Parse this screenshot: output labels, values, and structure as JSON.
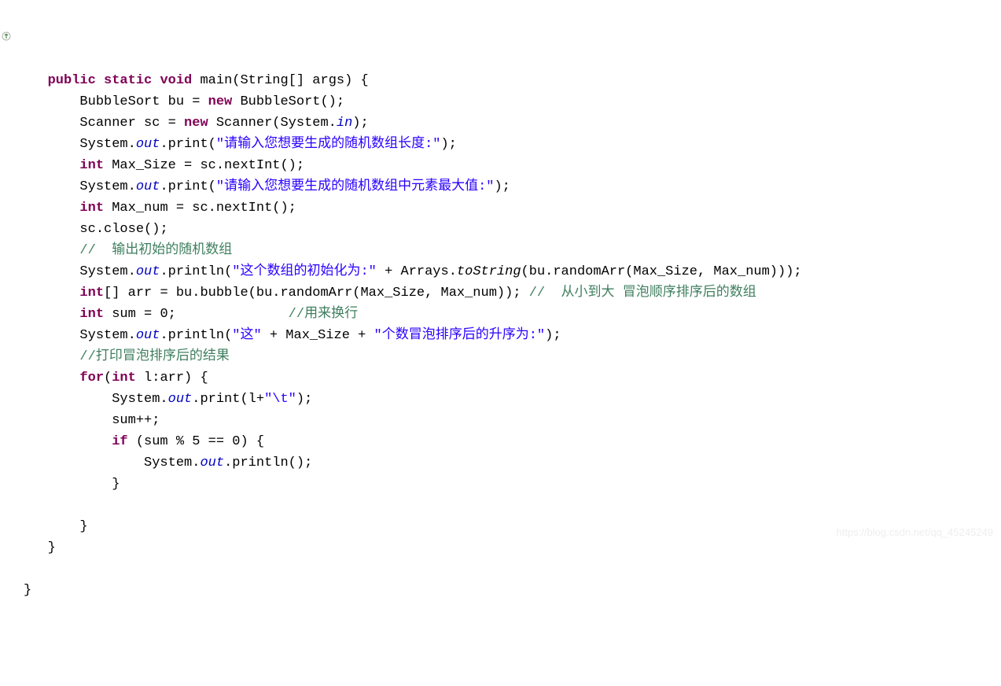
{
  "code": {
    "l1": {
      "kw1": "public",
      "kw2": "static",
      "kw3": "void",
      "name": "main",
      "args": "(String[] args) {"
    },
    "l2": {
      "a": "BubbleSort bu = ",
      "kw": "new",
      "b": " BubbleSort();"
    },
    "l3": {
      "a": "Scanner sc = ",
      "kw": "new",
      "b": " Scanner(System.",
      "field": "in",
      "c": ");"
    },
    "l4": {
      "a": "System.",
      "field": "out",
      "b": ".print(",
      "str": "\"请输入您想要生成的随机数组长度:\"",
      "c": ");"
    },
    "l5": {
      "kw": "int",
      "a": " Max_Size = sc.nextInt();"
    },
    "l6": {
      "a": "System.",
      "field": "out",
      "b": ".print(",
      "str": "\"请输入您想要生成的随机数组中元素最大值:\"",
      "c": ");"
    },
    "l7": {
      "kw": "int",
      "a": " Max_num = sc.nextInt();"
    },
    "l8": {
      "a": "sc.close();"
    },
    "l9": {
      "com": "//  输出初始的随机数组"
    },
    "l10": {
      "a": "System.",
      "field": "out",
      "b": ".println(",
      "str": "\"这个数组的初始化为:\"",
      "c": " + Arrays.",
      "sc": "toString",
      "d": "(bu.randomArr(Max_Size, Max_num)));"
    },
    "l11": {
      "kw": "int",
      "a": "[] arr = bu.bubble(bu.randomArr(Max_Size, Max_num)); ",
      "com": "//  从小到大 冒泡顺序排序后的数组"
    },
    "l12": {
      "kw": "int",
      "a": " sum = 0;              ",
      "com": "//用来换行"
    },
    "l13": {
      "a": "System.",
      "field": "out",
      "b": ".println(",
      "str1": "\"这\"",
      "c": " + Max_Size + ",
      "str2": "\"个数冒泡排序后的升序为:\"",
      "d": ");"
    },
    "l14": {
      "com": "//打印冒泡排序后的结果"
    },
    "l15": {
      "kw1": "for",
      "a": "(",
      "kw2": "int",
      "b": " l:arr) {"
    },
    "l16": {
      "a": "System.",
      "field": "out",
      "b": ".print(l+",
      "str": "\"\\t\"",
      "c": ");"
    },
    "l17": {
      "a": "sum++;"
    },
    "l18": {
      "kw": "if",
      "a": " (sum % 5 == 0) {"
    },
    "l19": {
      "a": "System.",
      "field": "out",
      "b": ".println();"
    },
    "l20": {
      "a": "}"
    },
    "l21": {
      "a": "}"
    },
    "l22": {
      "a": "}"
    },
    "l23": {
      "a": "}"
    }
  },
  "watermark": "https://blog.csdn.net/qq_45245249"
}
